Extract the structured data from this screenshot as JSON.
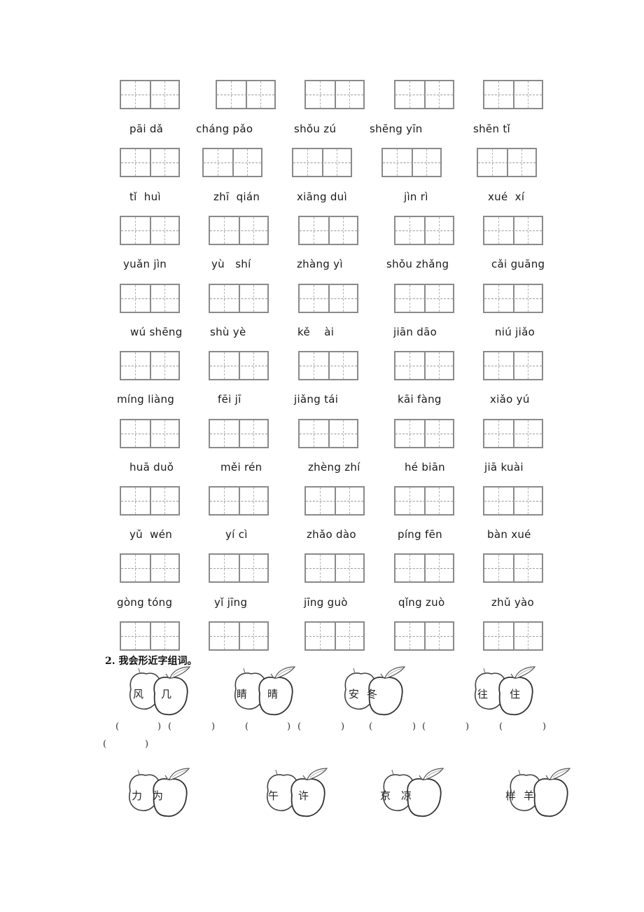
{
  "pinyin_rows": [
    [
      "pāi dǎ",
      "cháng pǎo",
      "shǒu zú",
      "shēng yīn",
      "shēn tǐ"
    ],
    [
      "tǐ  huì",
      "zhī  qián",
      "xiāng duì",
      "jìn rì",
      "xué  xí"
    ],
    [
      "yuǎn jìn",
      "yù   shí",
      "zhàng yì",
      "shǒu zhǎng",
      "cǎi guāng"
    ],
    [
      "wú shēng",
      "shù yè",
      "kě    ài",
      "jiān dāo",
      "niú jiǎo"
    ],
    [
      "míng liàng",
      "fēi jī",
      "jiǎng tái",
      "kāi fàng",
      "xiǎo yú"
    ],
    [
      "huā duǒ",
      "měi rén",
      "zhèng zhí",
      "hé biān",
      "jiā kuài"
    ],
    [
      "yǔ  wén",
      "yí cì",
      "zhǎo dào",
      "píng fēn",
      "bàn xué"
    ],
    [
      "gòng tóng",
      "yǐ jīng",
      "jīng guò",
      "qǐng zuò",
      "zhǔ yào"
    ]
  ],
  "section2": {
    "title": "2. 我会形近字组词。",
    "apples_row1": [
      {
        "left": "风",
        "right": "几"
      },
      {
        "left": "睛",
        "right": "晴"
      },
      {
        "left": "安",
        "right": "冬"
      },
      {
        "left": "往",
        "right": "住"
      }
    ],
    "apples_row2": [
      {
        "left": "力",
        "right": "为"
      },
      {
        "left": "午",
        "right": "许"
      },
      {
        "left": "京",
        "right": "凉"
      },
      {
        "left": "样",
        "right": "羊"
      }
    ],
    "paren_open": "(",
    "paren_close": ")"
  }
}
